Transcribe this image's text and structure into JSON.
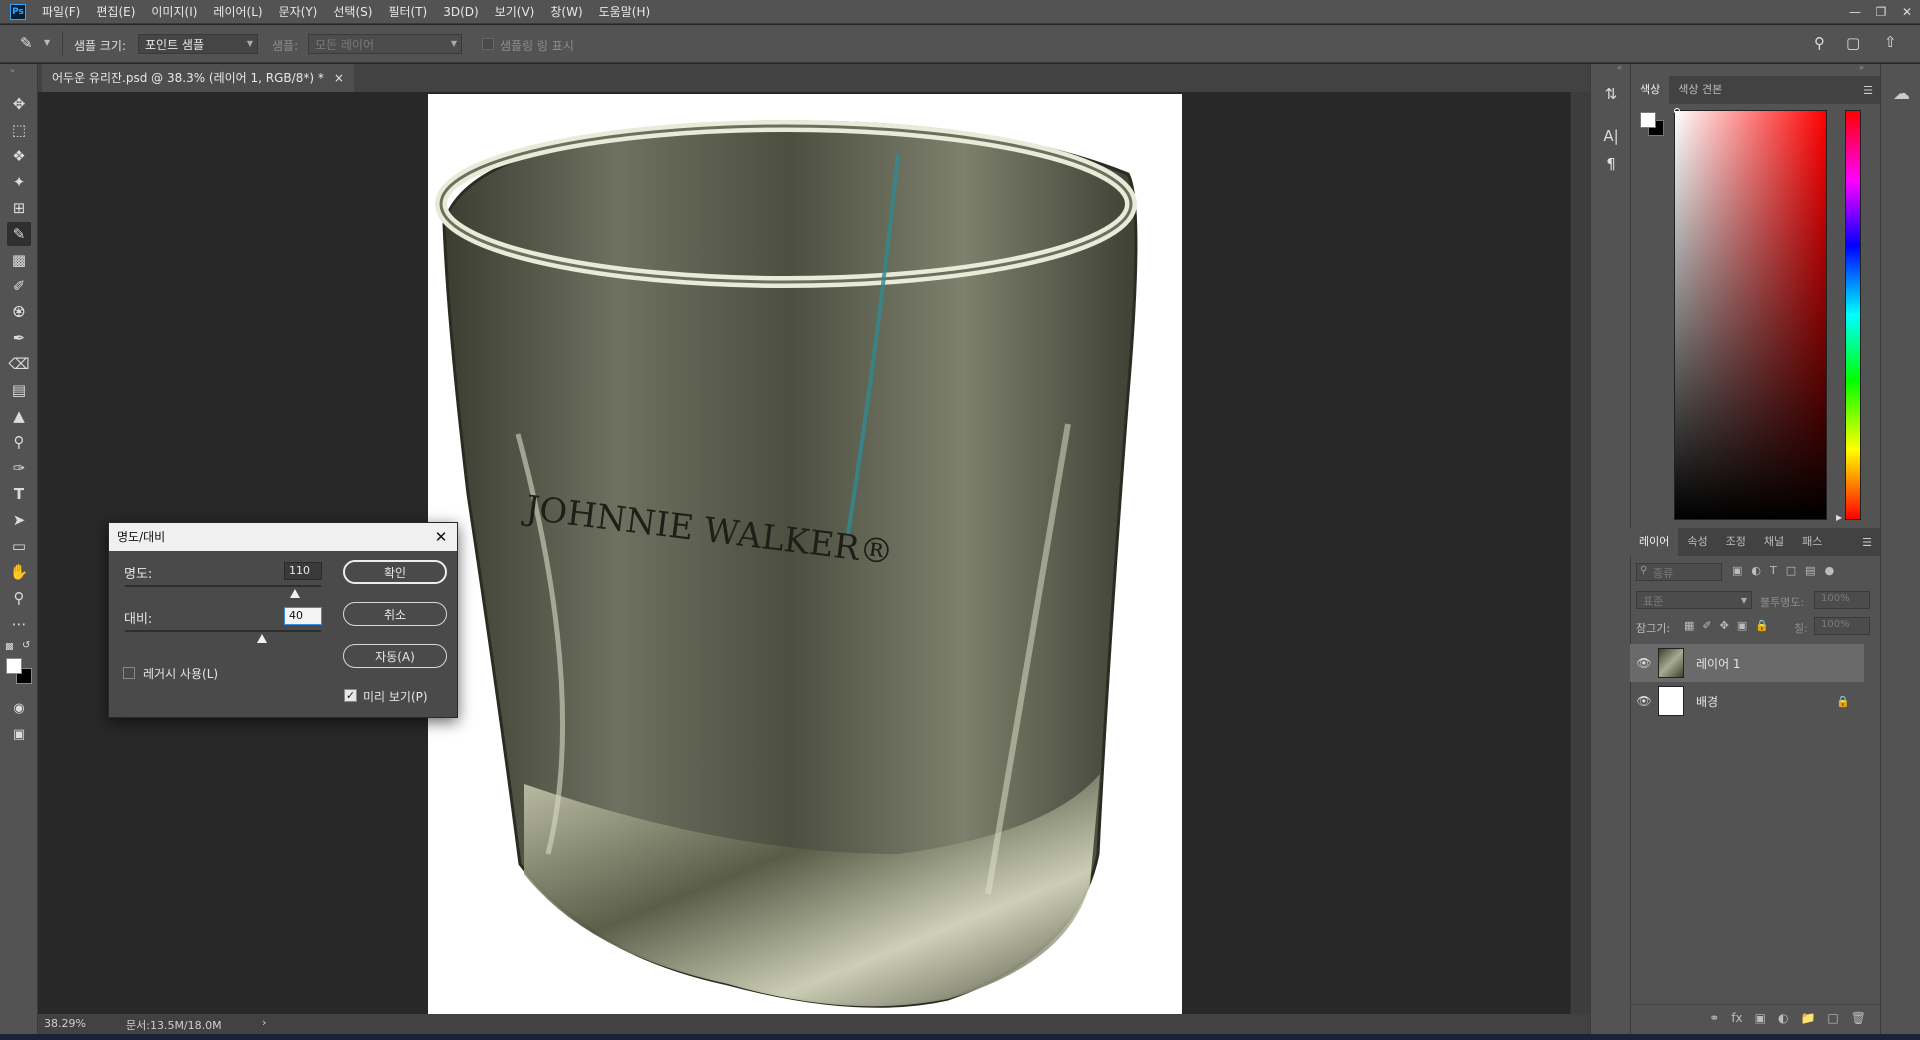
{
  "menu": {
    "items": [
      "파일(F)",
      "편집(E)",
      "이미지(I)",
      "레이어(L)",
      "문자(Y)",
      "선택(S)",
      "필터(T)",
      "3D(D)",
      "보기(V)",
      "창(W)",
      "도움말(H)"
    ]
  },
  "app_logo": "Ps",
  "options": {
    "sample_size_label": "샘플 크기:",
    "sample_size_value": "포인트 샘플",
    "sample_label": "샘플:",
    "sample_value": "모든 레이어",
    "show_ring_label": "샘플링 링 표시"
  },
  "document": {
    "tab_title": "어두운 유리잔.psd @ 38.3% (레이어 1, RGB/8*) *",
    "tab_close": "×"
  },
  "canvas": {
    "glass_text": "JOHNNIE WALKER®"
  },
  "status": {
    "zoom": "38.29%",
    "doc_size": "문서:13.5M/18.0M",
    "arrow": "›"
  },
  "color_panel": {
    "tabs": [
      "색상",
      "색상 견본"
    ]
  },
  "layers_panel": {
    "tabs": [
      "레이어",
      "속성",
      "조정",
      "채널",
      "패스"
    ],
    "kind_filter": "종류",
    "blend_mode": "표준",
    "opacity_label": "불투명도:",
    "opacity_value": "100%",
    "lock_label": "잠그기:",
    "fill_label": "칠:",
    "fill_value": "100%",
    "layers": [
      {
        "name": "레이어 1",
        "selected": true
      },
      {
        "name": "배경",
        "selected": false,
        "locked": true
      }
    ]
  },
  "dialog": {
    "title": "명도/대비",
    "brightness_label": "명도:",
    "brightness_value": "110",
    "contrast_label": "대비:",
    "contrast_value": "40",
    "legacy_label": "레거시 사용(L)",
    "preview_label": "미리 보기(P)",
    "ok_label": "확인",
    "cancel_label": "취소",
    "auto_label": "자동(A)"
  }
}
